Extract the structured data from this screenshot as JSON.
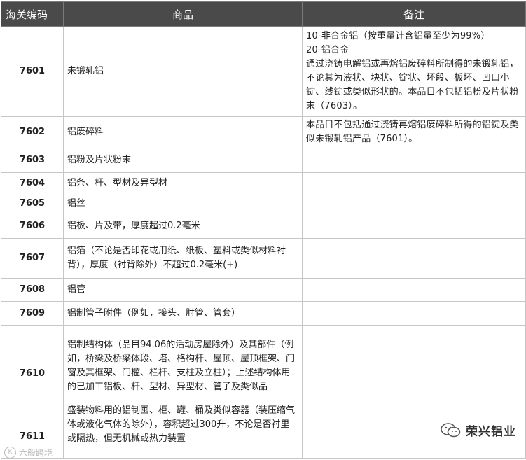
{
  "table": {
    "headers": [
      "海关编码",
      "商品",
      "备注"
    ],
    "rows": [
      {
        "code": "7601",
        "item": "未锻轧铝",
        "note": [
          "10-非合金铝（按重量计含铝量至少为99%）",
          "20-铝合金",
          "通过浇铸电解铝或再熔铝废碎料所制得的未锻轧铝，不论其为液状、块状、锭状、坯段、板坯、凹口小锭、线锭或类似形状的。本品目不包括铝粉及片状粉末（7603）。"
        ]
      },
      {
        "code": "7602",
        "item": "铝废碎料",
        "note": [
          "本品目不包括通过浇铸再熔铝废碎料所得的铝锭及类似未锻轧铝产品（7601）。"
        ]
      },
      {
        "code": "7603",
        "item": "铝粉及片状粉末",
        "note": []
      },
      {
        "code": "7604",
        "code2": "7605",
        "item": "铝条、杆、型材及异型材",
        "item2": "铝丝",
        "note": []
      },
      {
        "code": "7606",
        "item": "铝板、片及带，厚度超过0.2毫米",
        "note": []
      },
      {
        "code": "7607",
        "item": "铝箔（不论是否印花或用纸、纸板、塑料或类似材料衬背），厚度（衬背除外）不超过0.2毫米(+)",
        "note": []
      },
      {
        "code": "7608",
        "item": "铝管",
        "note": []
      },
      {
        "code": "7609",
        "item": "铝制管子附件（例如，接头、肘管、管套）",
        "note": []
      },
      {
        "code": "7610",
        "code2": "7611",
        "item": "铝制结构体（品目94.06的活动房屋除外）及其部件（例如，桥梁及桥梁体段、塔、格构杆、屋顶、屋顶框架、门窗及其框架、门槛、栏杆、支柱及立柱）；上述结构体用的已加工铝板、杆、型材、异型材、管子及类似品",
        "item2": "盛装物料用的铝制囤、柜、罐、桶及类似容器（装压缩气体或液化气体的除外），容积超过300升，不论是否衬里或隔热，但无机械或热力装置",
        "note": []
      }
    ]
  },
  "watermarks": {
    "left_text": "六般跨境",
    "left_icon": "circled-k-icon",
    "right_text": "荣兴铝业",
    "right_icon": "wechat-icon",
    "color_header": "#4a4a4a"
  }
}
